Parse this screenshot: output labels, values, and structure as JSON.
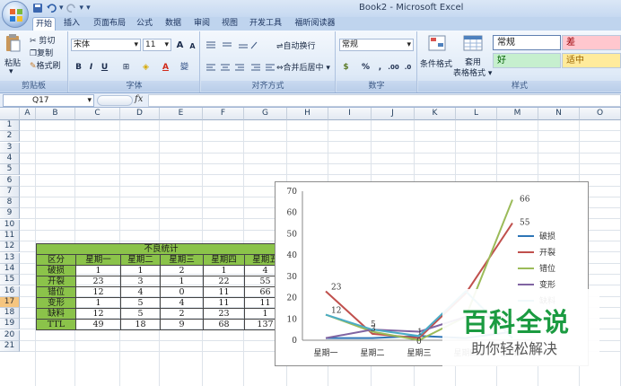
{
  "window": {
    "title": "Book2 - Microsoft Excel"
  },
  "tabs": [
    "开始",
    "插入",
    "页面布局",
    "公式",
    "数据",
    "审阅",
    "视图",
    "开发工具",
    "福昕阅读器"
  ],
  "clipboard": {
    "paste": "粘贴",
    "cut": "剪切",
    "copy": "复制",
    "painter": "格式刷",
    "group": "剪贴板"
  },
  "font": {
    "name": "宋体",
    "size": "11",
    "bold": "B",
    "italic": "I",
    "underline": "U",
    "group": "字体",
    "grow": "A",
    "shrink": "A",
    "color_a": "A",
    "wen": "變"
  },
  "alignment": {
    "wrap": "自动换行",
    "merge": "合并后居中",
    "group": "对齐方式"
  },
  "number": {
    "format": "常规",
    "percent": "%",
    "comma": ",",
    "group": "数字",
    "inc": ".00",
    "dec": ".0"
  },
  "styles": {
    "conditional": "条件格式",
    "table_fmt": "套用\n表格格式",
    "normal": "常规",
    "bad": "差",
    "good": "好",
    "neutral": "适中",
    "group": "样式"
  },
  "formula_bar": {
    "name_box": "Q17",
    "fx": "fx",
    "value": ""
  },
  "columns": [
    "A",
    "B",
    "C",
    "D",
    "E",
    "F",
    "G",
    "H",
    "I",
    "J",
    "K",
    "L",
    "M",
    "N",
    "O"
  ],
  "rows": [
    "1",
    "2",
    "3",
    "4",
    "5",
    "6",
    "7",
    "8",
    "9",
    "10",
    "11",
    "12",
    "13",
    "14",
    "15",
    "16",
    "17",
    "18",
    "19",
    "20",
    "21"
  ],
  "selected_row": "17",
  "table": {
    "title": "不良统计",
    "header": [
      "区分",
      "星期一",
      "星期二",
      "星期三",
      "星期四",
      "星期五"
    ],
    "rows": [
      [
        "破损",
        "1",
        "1",
        "2",
        "1",
        "4"
      ],
      [
        "开裂",
        "23",
        "3",
        "1",
        "22",
        "55"
      ],
      [
        "错位",
        "12",
        "4",
        "0",
        "11",
        "66"
      ],
      [
        "变形",
        "1",
        "5",
        "4",
        "11",
        "11"
      ],
      [
        "缺料",
        "12",
        "5",
        "2",
        "23",
        "1"
      ],
      [
        "TTL",
        "49",
        "18",
        "9",
        "68",
        "137"
      ]
    ]
  },
  "chart_data": {
    "type": "line",
    "categories": [
      "星期一",
      "星期二",
      "星期三",
      "星期四",
      "星期五"
    ],
    "ylim": [
      0,
      70
    ],
    "yticks": [
      "0",
      "10",
      "20",
      "30",
      "40",
      "50",
      "60",
      "70"
    ],
    "series": [
      {
        "name": "破损",
        "values": [
          1,
          1,
          2,
          1,
          4
        ],
        "color": "#2e75b6"
      },
      {
        "name": "开裂",
        "values": [
          23,
          3,
          1,
          22,
          55
        ],
        "color": "#c0504d"
      },
      {
        "name": "错位",
        "values": [
          12,
          4,
          0,
          11,
          66
        ],
        "color": "#9bbb59"
      },
      {
        "name": "变形",
        "values": [
          1,
          5,
          4,
          11,
          11
        ],
        "color": "#8064a2"
      },
      {
        "name": "缺料",
        "values": [
          12,
          5,
          2,
          23,
          1
        ],
        "color": "#4bacc6"
      }
    ],
    "data_labels": [
      "23",
      "12",
      "5",
      "3",
      "1",
      "0",
      "66",
      "55"
    ],
    "legend_position": "right"
  },
  "watermark": {
    "title": "百科全说",
    "subtitle": "助你轻松解决"
  }
}
